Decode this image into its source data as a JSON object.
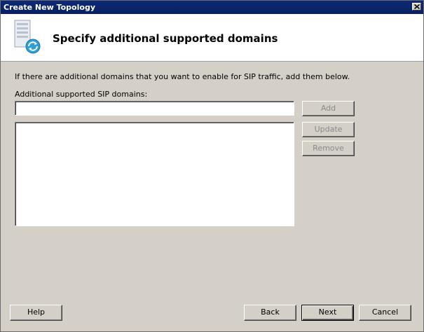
{
  "window": {
    "title": "Create New Topology",
    "close_icon": "close-icon"
  },
  "header": {
    "icon": "topology-server-icon",
    "title": "Specify additional supported domains"
  },
  "main": {
    "instruction": "If there are additional domains that you want to enable for SIP traffic, add them below.",
    "field_label": "Additional supported SIP domains:",
    "input_value": "",
    "domains": [],
    "add_label": "Add",
    "update_label": "Update",
    "remove_label": "Remove"
  },
  "footer": {
    "help_label": "Help",
    "back_label": "Back",
    "next_label": "Next",
    "cancel_label": "Cancel"
  },
  "colors": {
    "titlebar": "#0a246a",
    "dialog_bg": "#d4d0c8",
    "disabled_text": "#8a8a8a"
  }
}
